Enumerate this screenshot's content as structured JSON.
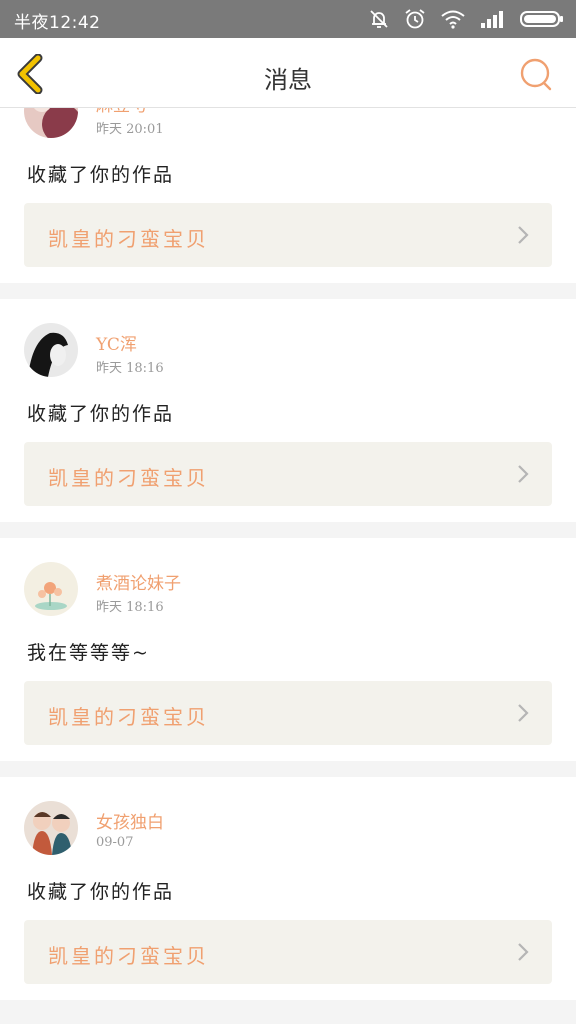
{
  "status_bar": {
    "time": "半夜12:42",
    "icons": [
      "mute-bell-icon",
      "alarm-icon",
      "wifi-icon",
      "signal-icon",
      "battery-icon"
    ]
  },
  "nav": {
    "title": "消息",
    "back_icon": "chevron-left-icon",
    "search_icon": "search-icon"
  },
  "colors": {
    "accent": "#f0a070",
    "nav_back": "#f2c200",
    "status_bar": "#7a7a7a",
    "work_bg": "#f3f2ec"
  },
  "messages": [
    {
      "username": "麻豆芍",
      "time": "昨天 20:01",
      "text": "收藏了你的作品",
      "work": "凯皇的刁蛮宝贝"
    },
    {
      "username": "YC浑",
      "time": "昨天 18:16",
      "text": "收藏了你的作品",
      "work": "凯皇的刁蛮宝贝"
    },
    {
      "username": "煮酒论妹子",
      "time": "昨天 18:16",
      "text": "我在等等等~",
      "work": "凯皇的刁蛮宝贝"
    },
    {
      "username": "女孩独白",
      "time": "09-07",
      "text": "收藏了你的作品",
      "work": "凯皇的刁蛮宝贝"
    }
  ]
}
